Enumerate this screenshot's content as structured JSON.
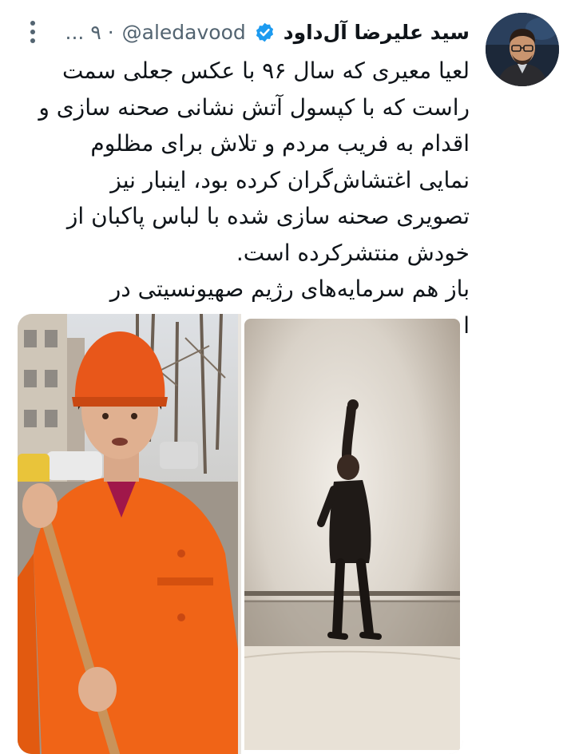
{
  "tweet": {
    "display_name": "سید علیرضا آل‌داود",
    "handle": "@aledavood",
    "meta": "... ۹ · ",
    "body": [
      "لعیا معیری که سال ۹۶ با عکس جعلی سمت راست که با کپسول آتش نشانی صحنه سازی و اقدام به فریب مردم و تلاش برای مظلوم نمایی اغتشاش‌گران کرده بود، اینبار نیز تصویری صحنه سازی شده با لباس پاکبان از خودش منتشرکرده است.",
      "باز هم سرمایه‌های رژیم صهیونسیتی در ایران..."
    ]
  },
  "icons": {
    "verified": "verified-badge-icon",
    "more": "more-options-icon"
  },
  "colors": {
    "verified_blue": "#1d9bf0",
    "secondary_text": "#536471",
    "primary_text": "#0f1419",
    "uniform_orange": "#f06417"
  }
}
